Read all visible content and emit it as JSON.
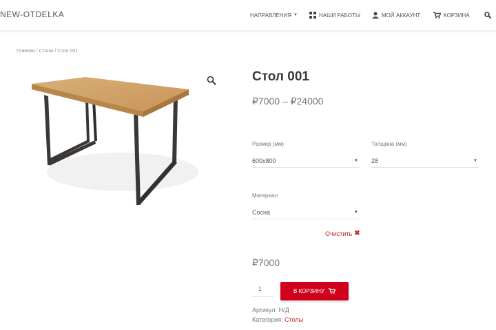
{
  "header": {
    "logo": "NEW-OTDELKA",
    "nav": {
      "directions": "НАПРАВЛЕНИЯ",
      "works": "НАШИ РАБОТЫ",
      "account": "МОЙ АККАУНТ",
      "cart": "КОРЗИНА"
    }
  },
  "breadcrumb": "Главная / Столы / Стол 001",
  "product": {
    "title": "Стол 001",
    "price_range": "₽7000 – ₽24000",
    "size": {
      "label": "Размер (мм)",
      "value": "600x800"
    },
    "thickness": {
      "label": "Толщина (мм)",
      "value": "28"
    },
    "material": {
      "label": "Материал",
      "value": "Сосна"
    },
    "clear_label": "Очистить",
    "price": "₽7000",
    "quantity": "1",
    "add_to_cart_label": "В КОРЗИНУ",
    "sku_label": "Артикул:",
    "sku_value": "Н/Д",
    "category_label": "Категория:",
    "category_value": "Столы"
  },
  "colors": {
    "accent": "#d0021b",
    "link": "#c32a2a"
  }
}
